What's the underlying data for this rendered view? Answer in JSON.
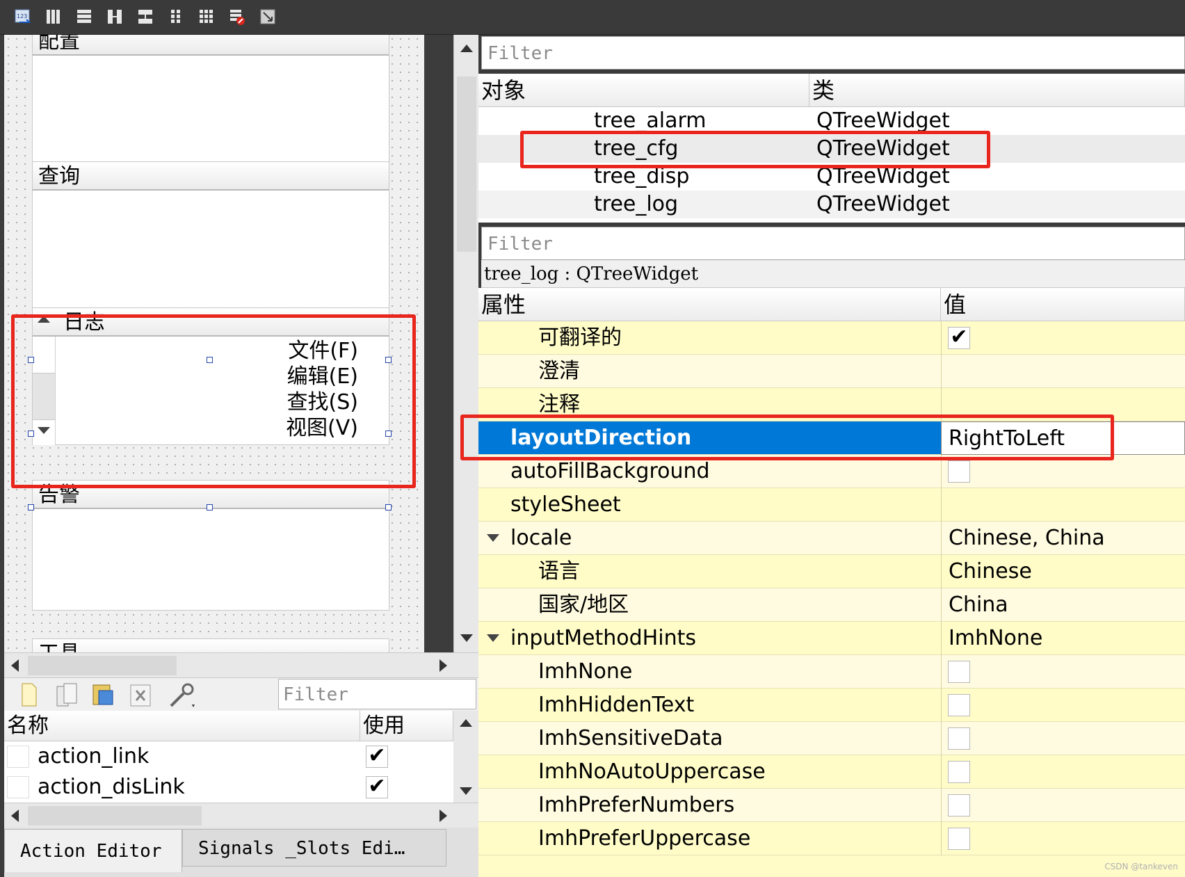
{
  "toolbar": {
    "icons": [
      "edit-tab-order-icon",
      "lay-out-horizontally-icon",
      "lay-out-vertically-icon",
      "lay-out-horizontal-splitter-icon",
      "lay-out-vertical-splitter-icon",
      "lay-out-form-icon",
      "lay-out-grid-icon",
      "break-layout-icon",
      "adjust-size-icon"
    ]
  },
  "form": {
    "groups": [
      {
        "title": "配置"
      },
      {
        "title": "查询"
      },
      {
        "title": "日志",
        "menu_items": [
          "文件(F)",
          "编辑(E)",
          "查找(S)",
          "视图(V)"
        ]
      },
      {
        "title": "告警"
      },
      {
        "title": "工具"
      }
    ]
  },
  "action_editor": {
    "filter_placeholder": "Filter",
    "columns": [
      "名称",
      "使用"
    ],
    "rows": [
      {
        "name": "action_link",
        "used": "✔"
      },
      {
        "name": "action_disLink",
        "used": "✔"
      }
    ],
    "tabs": [
      "Action Editor",
      "Signals _Slots Edi…"
    ]
  },
  "object_inspector": {
    "filter_placeholder": "Filter",
    "columns": [
      "对象",
      "类"
    ],
    "rows": [
      {
        "object": "tree_alarm",
        "class": "QTreeWidget"
      },
      {
        "object": "tree_cfg",
        "class": "QTreeWidget"
      },
      {
        "object": "tree_disp",
        "class": "QTreeWidget"
      },
      {
        "object": "tree_log",
        "class": "QTreeWidget"
      }
    ]
  },
  "property_editor": {
    "filter_placeholder": "Filter",
    "class_line": "tree_log : QTreeWidget",
    "columns": [
      "属性",
      "值"
    ],
    "rows": [
      {
        "name": "可翻译的",
        "value": "",
        "check": "✔"
      },
      {
        "name": "澄清",
        "value": ""
      },
      {
        "name": "注释",
        "value": ""
      },
      {
        "name": "layoutDirection",
        "value": "RightToLeft",
        "selected": true
      },
      {
        "name": "autoFillBackground",
        "value": "",
        "check": ""
      },
      {
        "name": "styleSheet",
        "value": ""
      },
      {
        "name": "locale",
        "value": "Chinese, China",
        "expand": true
      },
      {
        "name": "语言",
        "value": "Chinese"
      },
      {
        "name": "国家/地区",
        "value": "China"
      },
      {
        "name": "inputMethodHints",
        "value": "ImhNone",
        "expand": true
      },
      {
        "name": "ImhNone",
        "value": "",
        "check": ""
      },
      {
        "name": "ImhHiddenText",
        "value": "",
        "check": ""
      },
      {
        "name": "ImhSensitiveData",
        "value": "",
        "check": ""
      },
      {
        "name": "ImhNoAutoUppercase",
        "value": "",
        "check": ""
      },
      {
        "name": "ImhPreferNumbers",
        "value": "",
        "check": ""
      },
      {
        "name": "ImhPreferUppercase",
        "value": "",
        "check": ""
      }
    ]
  },
  "watermark": "CSDN @tankeven",
  "colors": {
    "selection": "#0078d7",
    "highlight_box": "#e8261e",
    "property_bg": "#fffcc8"
  }
}
